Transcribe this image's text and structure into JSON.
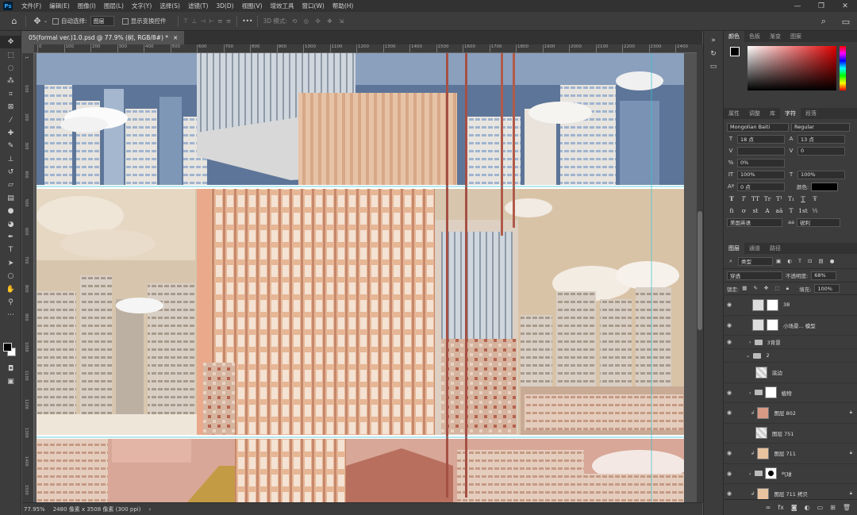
{
  "menubar": {
    "logo": "Ps",
    "items": [
      "文件(F)",
      "编辑(E)",
      "图像(I)",
      "图层(L)",
      "文字(Y)",
      "选择(S)",
      "滤镜(T)",
      "3D(D)",
      "视图(V)",
      "增效工具",
      "窗口(W)",
      "帮助(H)"
    ],
    "minimize": "—",
    "maximize": "❐",
    "close": "✕"
  },
  "options": {
    "auto_select_label": "自动选择:",
    "auto_select_value": "图层",
    "show_transform_label": "显示变换控件",
    "more": "•••",
    "mode_3d": "3D 模式:"
  },
  "document": {
    "tab_title": "05(formal ver.)1.0.psd @ 77.9% (树, RGB/8#) *",
    "close": "×"
  },
  "ruler": {
    "h_ticks": [
      "0",
      "100",
      "200",
      "300",
      "400",
      "500",
      "600",
      "700",
      "800",
      "900",
      "1000",
      "1100",
      "1200",
      "1300",
      "1400",
      "1500",
      "1600",
      "1700",
      "1800",
      "1900",
      "2000",
      "2100",
      "2200",
      "2300",
      "2400"
    ],
    "v_ticks": [
      "1",
      "100",
      "200",
      "300",
      "400",
      "500",
      "600",
      "700",
      "800",
      "900",
      "1000",
      "1100",
      "1200",
      "1300",
      "1400",
      "1500"
    ]
  },
  "status": {
    "zoom": "77.95%",
    "doc_size": "2480 像素 x 3508 像素 (300 ppi)",
    "arrow": "›"
  },
  "color_panel": {
    "tabs": [
      "颜色",
      "色板",
      "渐变",
      "图案"
    ],
    "fg_color": "#000000",
    "bg_color": "#ffffff"
  },
  "char_panel": {
    "tabs": [
      "属性",
      "调整",
      "库",
      "字符",
      "段落"
    ],
    "font_family": "Mongolian Baiti",
    "font_style": "Regular",
    "font_size": "18 点",
    "leading": "13 点",
    "kerning": "",
    "tracking": "0",
    "scale_pct": "0%",
    "v_scale": "100%",
    "h_scale": "100%",
    "baseline": "0 点",
    "color_label": "颜色:",
    "type_buttons": [
      "T",
      "T",
      "TT",
      "Tr",
      "T¹",
      "T₁",
      "T",
      "Ŧ"
    ],
    "opentype_buttons": [
      "fi",
      "ơ",
      "st",
      "A",
      "aā",
      "T",
      "1st",
      "½"
    ],
    "language": "美国英语",
    "aa_icon": "aa",
    "antialias": "锐利"
  },
  "layers_panel": {
    "tabs": [
      "图层",
      "通道",
      "路径"
    ],
    "filter_kind": "类型",
    "blend_mode": "穿透",
    "opacity_label": "不透明度:",
    "opacity_value": "68%",
    "lock_label": "锁定:",
    "fill_label": "填充:",
    "fill_value": "100%",
    "layers": [
      {
        "name": "38",
        "kind": "masked",
        "visible": true
      },
      {
        "name": "小场景... 模型",
        "kind": "masked",
        "visible": true
      },
      {
        "name": "3背景",
        "kind": "group",
        "visible": true
      },
      {
        "name": "2",
        "kind": "group-open",
        "visible": false
      },
      {
        "name": "底边",
        "kind": "plain",
        "visible": false
      },
      {
        "name": "植物",
        "kind": "group-masked",
        "visible": true
      },
      {
        "name": "图层 802",
        "kind": "clip",
        "visible": true,
        "locked": true
      },
      {
        "name": "图层 751",
        "kind": "plain",
        "visible": false
      },
      {
        "name": "图层 711",
        "kind": "clip",
        "visible": true,
        "locked": true
      },
      {
        "name": "气球",
        "kind": "group-masked",
        "visible": true
      },
      {
        "name": "图层 711 拷贝",
        "kind": "clip",
        "visible": true,
        "locked": true
      }
    ],
    "footer_icons": [
      "link-icon",
      "fx-icon",
      "mask-icon",
      "adjust-icon",
      "folder-icon",
      "new-layer-icon",
      "trash-icon"
    ]
  }
}
